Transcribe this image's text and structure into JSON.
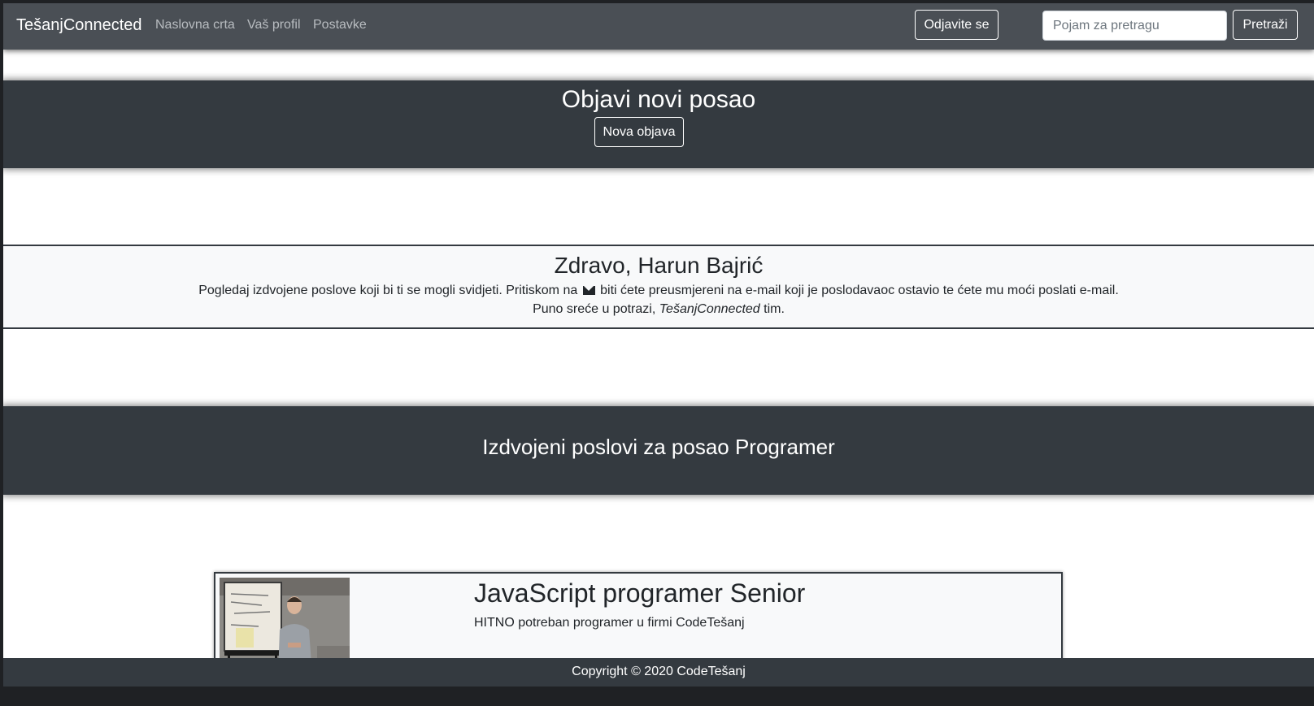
{
  "navbar": {
    "brand": "TešanjConnected",
    "links": [
      "Naslovna crta",
      "Vaš profil",
      "Postavke"
    ],
    "logout_label": "Odjavite se",
    "search_placeholder": "Pojam za pretragu",
    "search_button": "Pretraži"
  },
  "post_job": {
    "title": "Objavi novi posao",
    "button": "Nova objava"
  },
  "greeting": {
    "title": "Zdravo, Harun Bajrić",
    "line1_before": "Pogledaj izdvojene poslove koji bi ti se mogli svidjeti. Pritiskom na",
    "line1_after": "biti ćete preusmjereni na e-mail koji je poslodavaoc ostavio te ćete mu moći poslati e-mail.",
    "line2_before": "Puno sreće u potrazi,",
    "line2_brand": "TešanjConnected",
    "line2_after": "tim."
  },
  "featured": {
    "title": "Izdvojeni poslovi za posao Programer"
  },
  "jobs": [
    {
      "title": "JavaScript programer Senior",
      "description": "HITNO potreban programer u firmi CodeTešanj"
    }
  ],
  "footer": {
    "text": "Copyright © 2020 CodeTešanj"
  },
  "icons": {
    "greeting_icon": "envelope-icon"
  }
}
